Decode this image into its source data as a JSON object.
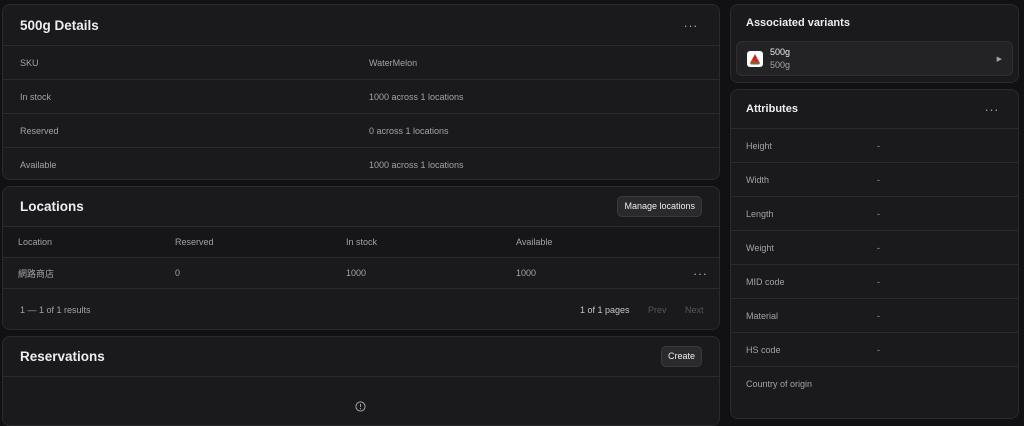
{
  "details": {
    "title": "500g Details",
    "more_icon": "ellipsis-icon",
    "rows": [
      {
        "label": "SKU",
        "value": "WaterMelon"
      },
      {
        "label": "In stock",
        "value": "1000 across 1 locations"
      },
      {
        "label": "Reserved",
        "value": "0 across 1 locations"
      },
      {
        "label": "Available",
        "value": "1000 across 1 locations"
      }
    ]
  },
  "locations": {
    "title": "Locations",
    "manage_label": "Manage locations",
    "columns": [
      "Location",
      "Reserved",
      "In stock",
      "Available"
    ],
    "rows": [
      {
        "location": "網路商店",
        "reserved": "0",
        "in_stock": "1000",
        "available": "1000"
      }
    ],
    "results_text": "1 — 1 of 1 results",
    "pages_text": "1 of 1 pages",
    "prev_label": "Prev",
    "next_label": "Next"
  },
  "reservations": {
    "title": "Reservations",
    "create_label": "Create",
    "empty_icon": "info-circle-icon"
  },
  "associated_variants": {
    "title": "Associated variants",
    "items": [
      {
        "title": "500g",
        "subtitle": "500g"
      }
    ]
  },
  "attributes": {
    "title": "Attributes",
    "rows": [
      {
        "label": "Height",
        "value": "-"
      },
      {
        "label": "Width",
        "value": "-"
      },
      {
        "label": "Length",
        "value": "-"
      },
      {
        "label": "Weight",
        "value": "-"
      },
      {
        "label": "MID code",
        "value": "-"
      },
      {
        "label": "Material",
        "value": "-"
      },
      {
        "label": "HS code",
        "value": "-"
      },
      {
        "label": "Country of origin",
        "value": ""
      }
    ]
  },
  "colors": {
    "background": "#111113",
    "card": "#1a1a1c",
    "border": "#2b2b2e",
    "muted_text": "#a1a1aa",
    "text": "#ededed"
  }
}
